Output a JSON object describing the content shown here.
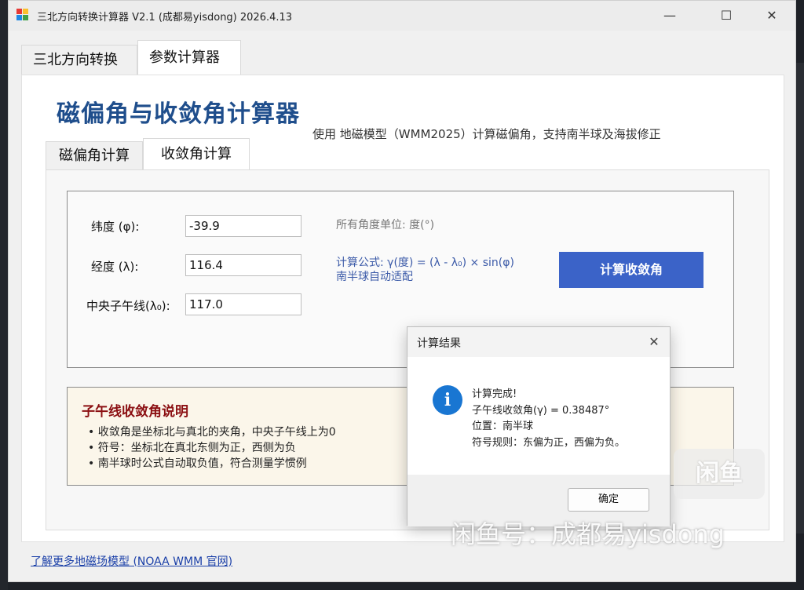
{
  "window": {
    "title": "三北方向转换计算器 V2.1 (成都易yisdong) 2026.4.13",
    "minimize": "—",
    "maximize": "☐",
    "close": "✕"
  },
  "main_tabs": [
    "三北方向转换",
    "参数计算器"
  ],
  "heading": "磁偏角与收敛角计算器",
  "subtitle": "使用 地磁模型（WMM2025）计算磁偏角，支持南半球及海拔修正",
  "sub_tabs": [
    "磁偏角计算",
    "收敛角计算"
  ],
  "form": {
    "latitude_label": "纬度 (φ):",
    "latitude_value": "-39.9",
    "longitude_label": "经度 (λ):",
    "longitude_value": "116.4",
    "meridian_label": "中央子午线(λ₀):",
    "meridian_value": "117.0",
    "unit_note": "所有角度单位: 度(°)",
    "formula_line1": "计算公式: γ(度) = (λ - λ₀) × sin(φ)",
    "formula_line2": "南半球自动适配",
    "calc_button": "计算收敛角"
  },
  "notes": {
    "title": "子午线收敛角说明",
    "items": [
      "• 收敛角是坐标北与真北的夹角，中央子午线上为0",
      "• 符号：坐标北在真北东侧为正，西侧为负",
      "• 南半球时公式自动取负值，符合测量学惯例"
    ]
  },
  "link": "了解更多地磁场模型 (NOAA WMM 官网)",
  "dialog": {
    "title": "计算结果",
    "close": "✕",
    "lines": [
      "计算完成!",
      "子午线收敛角(γ) = 0.38487°",
      "位置：南半球",
      "符号规则：东偏为正，西偏为负。"
    ],
    "ok_button": "确定"
  },
  "watermark": {
    "logo_text": "闲鱼",
    "text": "闲鱼号：成都易yisdong"
  },
  "colors": {
    "heading": "#1f4e8c",
    "button": "#3b63c8",
    "note_title": "#8b0f12",
    "info_icon": "#1976d2"
  }
}
